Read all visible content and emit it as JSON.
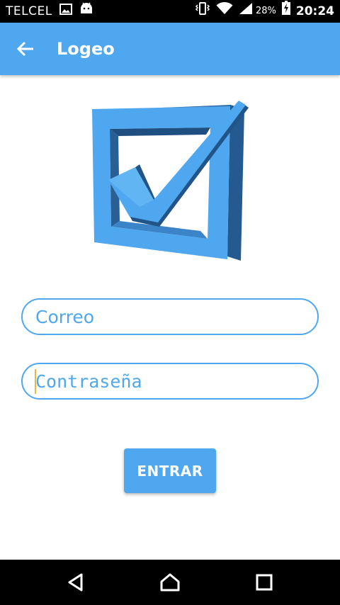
{
  "status_bar": {
    "carrier": "TELCEL",
    "battery_percent": "28%",
    "time": "20:24"
  },
  "app_bar": {
    "title": "Logeo",
    "color": "#4fa8ef"
  },
  "logo": {
    "icon": "checkbox-checked-icon"
  },
  "form": {
    "email_placeholder": "Correo",
    "email_value": "",
    "password_placeholder": "Contraseña",
    "password_value": "",
    "submit_label": "ENTRAR"
  },
  "nav_bar": {
    "icons": [
      "back-triangle-icon",
      "home-icon",
      "recents-icon"
    ]
  }
}
